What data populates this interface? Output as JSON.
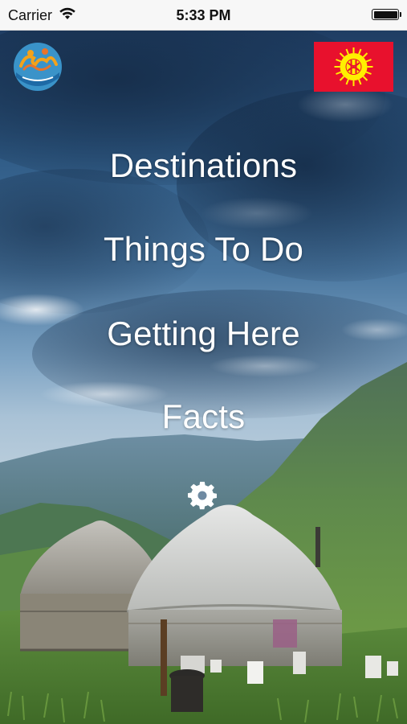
{
  "status_bar": {
    "carrier": "Carrier",
    "time": "5:33 PM",
    "wifi_icon": "wifi-icon",
    "battery_icon": "battery-icon"
  },
  "header": {
    "logo_icon": "kyrgyz-ornament-logo-icon",
    "flag_icon": "kyrgyzstan-flag-icon"
  },
  "menu": {
    "items": [
      {
        "label": "Destinations"
      },
      {
        "label": "Things To Do"
      },
      {
        "label": "Getting Here"
      },
      {
        "label": "Facts"
      }
    ],
    "settings_icon": "gear-icon"
  },
  "colors": {
    "status_bar_bg": "#f7f7f7",
    "menu_text": "#ffffff",
    "flag_red": "#e8112d",
    "flag_sun": "#ffef00"
  }
}
